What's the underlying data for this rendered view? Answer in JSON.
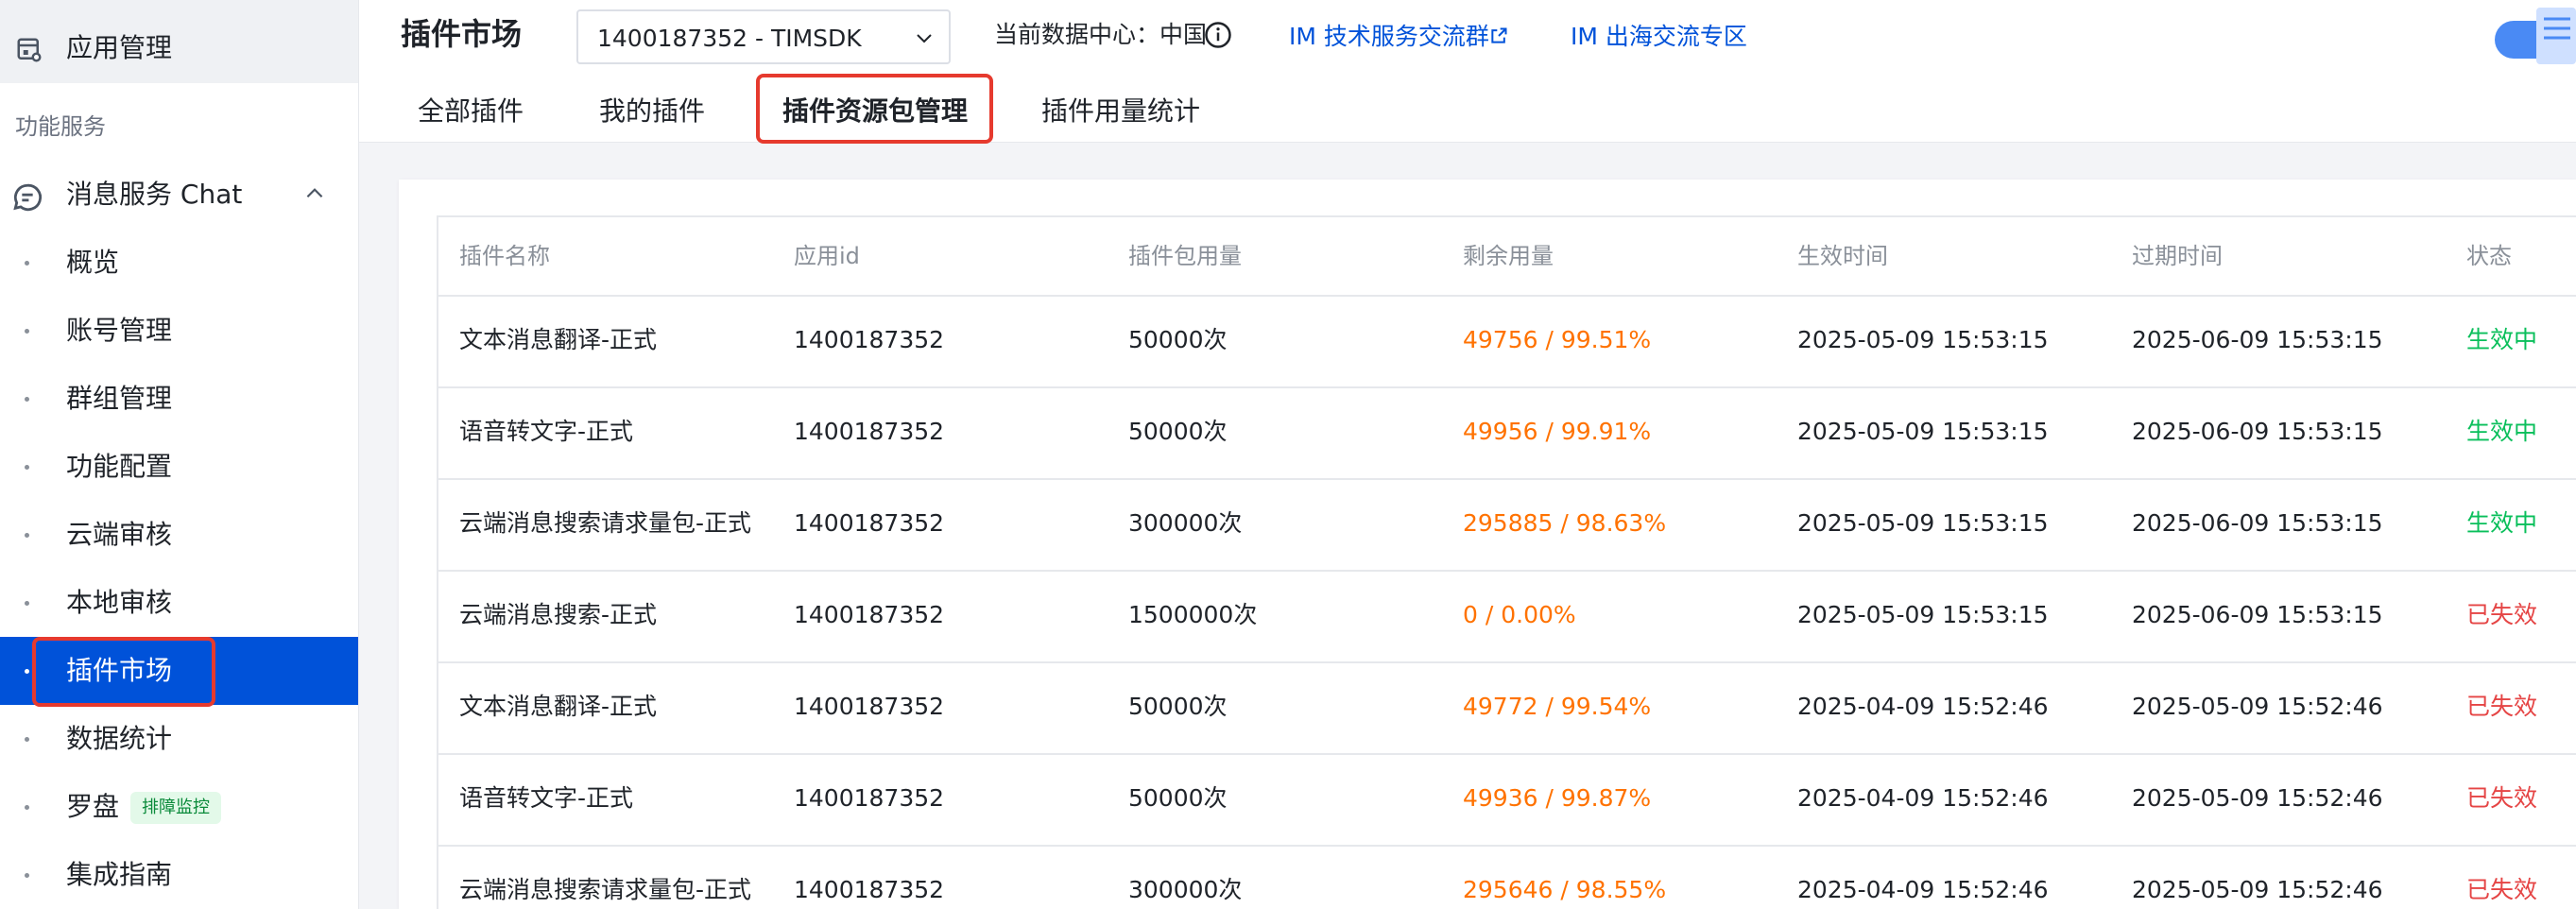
{
  "sidebar": {
    "app_management": "应用管理",
    "section_title": "功能服务",
    "chat_group": "消息服务 Chat",
    "items": [
      {
        "label": "概览"
      },
      {
        "label": "账号管理"
      },
      {
        "label": "群组管理"
      },
      {
        "label": "功能配置"
      },
      {
        "label": "云端审核"
      },
      {
        "label": "本地审核"
      },
      {
        "label": "插件市场"
      },
      {
        "label": "数据统计"
      },
      {
        "label": "罗盘",
        "badge": "排障监控"
      },
      {
        "label": "集成指南"
      }
    ],
    "active_item": "插件市场"
  },
  "header": {
    "title": "插件市场",
    "app_select_value": "1400187352 - TIMSDK",
    "datacenter_label": "当前数据中心：中国",
    "links": [
      "IM 技术服务交流群",
      "IM 出海交流专区"
    ],
    "tabs": [
      "全部插件",
      "我的插件",
      "插件资源包管理",
      "插件用量统计"
    ],
    "active_tab": "插件资源包管理"
  },
  "table": {
    "columns": [
      "插件名称",
      "应用id",
      "插件包用量",
      "剩余用量",
      "生效时间",
      "过期时间",
      "状态"
    ],
    "rows": [
      {
        "name": "文本消息翻译-正式",
        "app_id": "1400187352",
        "quota": "50000次",
        "remaining": "49756 / 99.51%",
        "start": "2025-05-09 15:53:15",
        "end": "2025-06-09 15:53:15",
        "status": "生效中"
      },
      {
        "name": "语音转文字-正式",
        "app_id": "1400187352",
        "quota": "50000次",
        "remaining": "49956 / 99.91%",
        "start": "2025-05-09 15:53:15",
        "end": "2025-06-09 15:53:15",
        "status": "生效中"
      },
      {
        "name": "云端消息搜索请求量包-正式",
        "app_id": "1400187352",
        "quota": "300000次",
        "remaining": "295885 / 98.63%",
        "start": "2025-05-09 15:53:15",
        "end": "2025-06-09 15:53:15",
        "status": "生效中"
      },
      {
        "name": "云端消息搜索-正式",
        "app_id": "1400187352",
        "quota": "1500000次",
        "remaining": "0 / 0.00%",
        "start": "2025-05-09 15:53:15",
        "end": "2025-06-09 15:53:15",
        "status": "已失效"
      },
      {
        "name": "文本消息翻译-正式",
        "app_id": "1400187352",
        "quota": "50000次",
        "remaining": "49772 / 99.54%",
        "start": "2025-04-09 15:52:46",
        "end": "2025-05-09 15:52:46",
        "status": "已失效"
      },
      {
        "name": "语音转文字-正式",
        "app_id": "1400187352",
        "quota": "50000次",
        "remaining": "49936 / 99.87%",
        "start": "2025-04-09 15:52:46",
        "end": "2025-05-09 15:52:46",
        "status": "已失效"
      },
      {
        "name": "云端消息搜索请求量包-正式",
        "app_id": "1400187352",
        "quota": "300000次",
        "remaining": "295646 / 98.55%",
        "start": "2025-04-09 15:52:46",
        "end": "2025-05-09 15:52:46",
        "status": "已失效"
      }
    ]
  },
  "colors": {
    "accent": "#0052d9",
    "remaining": "#ff7200",
    "status_active": "#0abf5b",
    "status_expired": "#e54545",
    "highlight_outline": "#e63a2e"
  }
}
